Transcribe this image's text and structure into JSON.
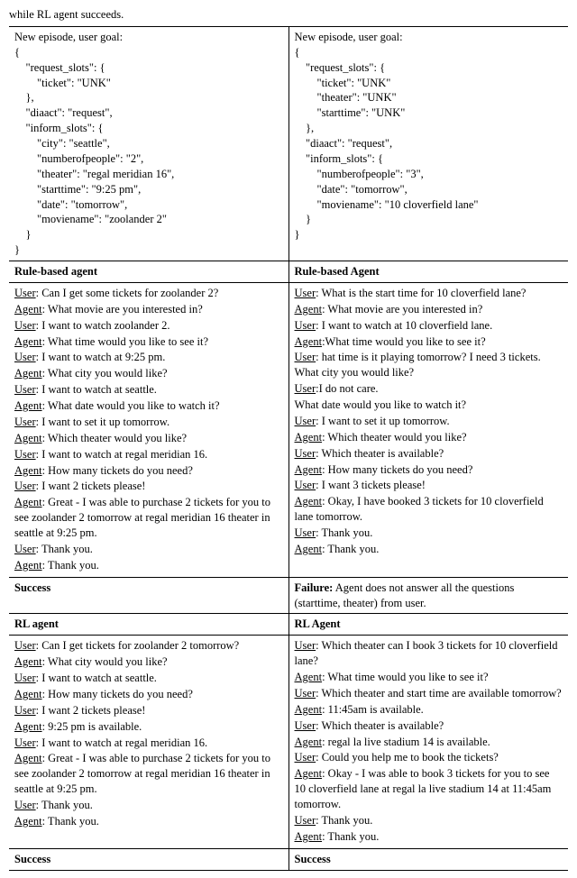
{
  "caption_fragment": "while RL agent succeeds.",
  "left": {
    "goal_title": "New episode, user goal:",
    "goal_json": "{\n    \"request_slots\": {\n        \"ticket\": \"UNK\"\n    },\n    \"diaact\": \"request\",\n    \"inform_slots\": {\n        \"city\": \"seattle\",\n        \"numberofpeople\": \"2\",\n        \"theater\": \"regal meridian 16\",\n        \"starttime\": \"9:25 pm\",\n        \"date\": \"tomorrow\",\n        \"moviename\": \"zoolander 2\"\n    }\n}",
    "rule_header": "Rule-based agent",
    "rule_dialog": [
      {
        "s": "User",
        "t": ": Can I get some tickets for zoolander 2?"
      },
      {
        "s": "Agent",
        "t": ": What movie are you interested in?"
      },
      {
        "s": "User",
        "t": ": I want to watch zoolander 2."
      },
      {
        "s": "Agent",
        "t": ": What time would you like to see it?"
      },
      {
        "s": "User",
        "t": ": I want to watch at 9:25 pm."
      },
      {
        "s": "Agent",
        "t": ": What city you would like?"
      },
      {
        "s": "User",
        "t": ": I want to watch at seattle."
      },
      {
        "s": "Agent",
        "t": ": What date would you like to watch it?"
      },
      {
        "s": "User",
        "t": ": I want to set it up tomorrow."
      },
      {
        "s": "Agent",
        "t": ": Which theater would you like?"
      },
      {
        "s": "User",
        "t": ": I want to watch at regal meridian 16."
      },
      {
        "s": "Agent",
        "t": ": How many tickets do you need?"
      },
      {
        "s": "User",
        "t": ": I want 2 tickets please!"
      },
      {
        "s": "Agent",
        "t": ": Great - I was able to purchase 2 tickets for you to see zoolander 2 tomorrow at regal meridian 16 theater in seattle at 9:25 pm."
      },
      {
        "s": "User",
        "t": ": Thank you."
      },
      {
        "s": "Agent",
        "t": ": Thank you."
      }
    ],
    "rule_outcome_label": "Success",
    "rule_outcome_detail": "",
    "rl_header": "RL agent",
    "rl_dialog": [
      {
        "s": "User",
        "t": ": Can I get tickets for zoolander 2 tomorrow?"
      },
      {
        "s": "Agent",
        "t": ": What city would you like?"
      },
      {
        "s": "User",
        "t": ": I want to watch at seattle."
      },
      {
        "s": "Agent",
        "t": ": How many tickets do you need?"
      },
      {
        "s": "User",
        "t": ": I want 2 tickets please!"
      },
      {
        "s": "Agent",
        "t": ": 9:25 pm is available."
      },
      {
        "s": "User",
        "t": ": I want to watch at regal meridian 16."
      },
      {
        "s": "Agent",
        "t": ": Great - I was able to purchase 2 tickets for you to see zoolander 2 tomorrow at regal meridian 16 theater in seattle at 9:25 pm."
      },
      {
        "s": "User",
        "t": ": Thank you."
      },
      {
        "s": "Agent",
        "t": ": Thank you."
      }
    ],
    "rl_outcome_label": "Success",
    "rl_outcome_detail": ""
  },
  "right": {
    "goal_title": "New episode, user goal:",
    "goal_json": "{\n    \"request_slots\": {\n        \"ticket\": \"UNK\"\n        \"theater\": \"UNK\"\n        \"starttime\": \"UNK\"\n    },\n    \"diaact\": \"request\",\n    \"inform_slots\": {\n        \"numberofpeople\": \"3\",\n        \"date\": \"tomorrow\",\n        \"moviename\": \"10 cloverfield lane\"\n    }\n}",
    "rule_header": "Rule-based Agent",
    "rule_dialog": [
      {
        "s": "User",
        "t": ": What is the start time for 10 cloverfield lane?"
      },
      {
        "s": "Agent",
        "t": ": What movie are you interested in?"
      },
      {
        "s": "User",
        "t": ": I want to watch at 10 cloverfield lane."
      },
      {
        "s": "Agent",
        "t": ":What time would you like to see it?"
      },
      {
        "s": "User",
        "t": ": hat time is it playing tomorrow? I need 3 tickets. What city you would like?"
      },
      {
        "s": "User",
        "t": ":I do not care."
      },
      {
        "s": "",
        "t": "What date would you like to watch it?"
      },
      {
        "s": "User",
        "t": ": I want to set it up tomorrow."
      },
      {
        "s": "Agent",
        "t": ": Which theater would you like?"
      },
      {
        "s": "User",
        "t": ": Which theater is available?"
      },
      {
        "s": "Agent",
        "t": ": How many tickets do you need?"
      },
      {
        "s": "User",
        "t": ": I want 3 tickets please!"
      },
      {
        "s": "Agent",
        "t": ": Okay, I have booked 3 tickets for 10 cloverfield lane tomorrow."
      },
      {
        "s": "User",
        "t": ": Thank you."
      },
      {
        "s": "Agent",
        "t": ": Thank you."
      }
    ],
    "rule_outcome_label": "Failure:",
    "rule_outcome_detail": " Agent does not answer all the questions (starttime, theater) from user.",
    "rl_header": "RL Agent",
    "rl_dialog": [
      {
        "s": "User",
        "t": ": Which theater can I book 3 tickets for 10 cloverfield lane?"
      },
      {
        "s": "Agent",
        "t": ": What time would you like to see it?"
      },
      {
        "s": "User",
        "t": ": Which theater and start time are available tomorrow?"
      },
      {
        "s": "Agent",
        "t": ": 11:45am is available."
      },
      {
        "s": "User",
        "t": ": Which theater is available?"
      },
      {
        "s": "Agent",
        "t": ": regal la live stadium 14 is available."
      },
      {
        "s": "User",
        "t": ": Could you help me to book the tickets?"
      },
      {
        "s": "Agent",
        "t": ": Okay - I was able to book 3 tickets for you to see 10 cloverfield lane at regal la live stadium 14 at 11:45am tomorrow."
      },
      {
        "s": "User",
        "t": ": Thank you."
      },
      {
        "s": "Agent",
        "t": ": Thank you."
      }
    ],
    "rl_outcome_label": "Success",
    "rl_outcome_detail": ""
  }
}
